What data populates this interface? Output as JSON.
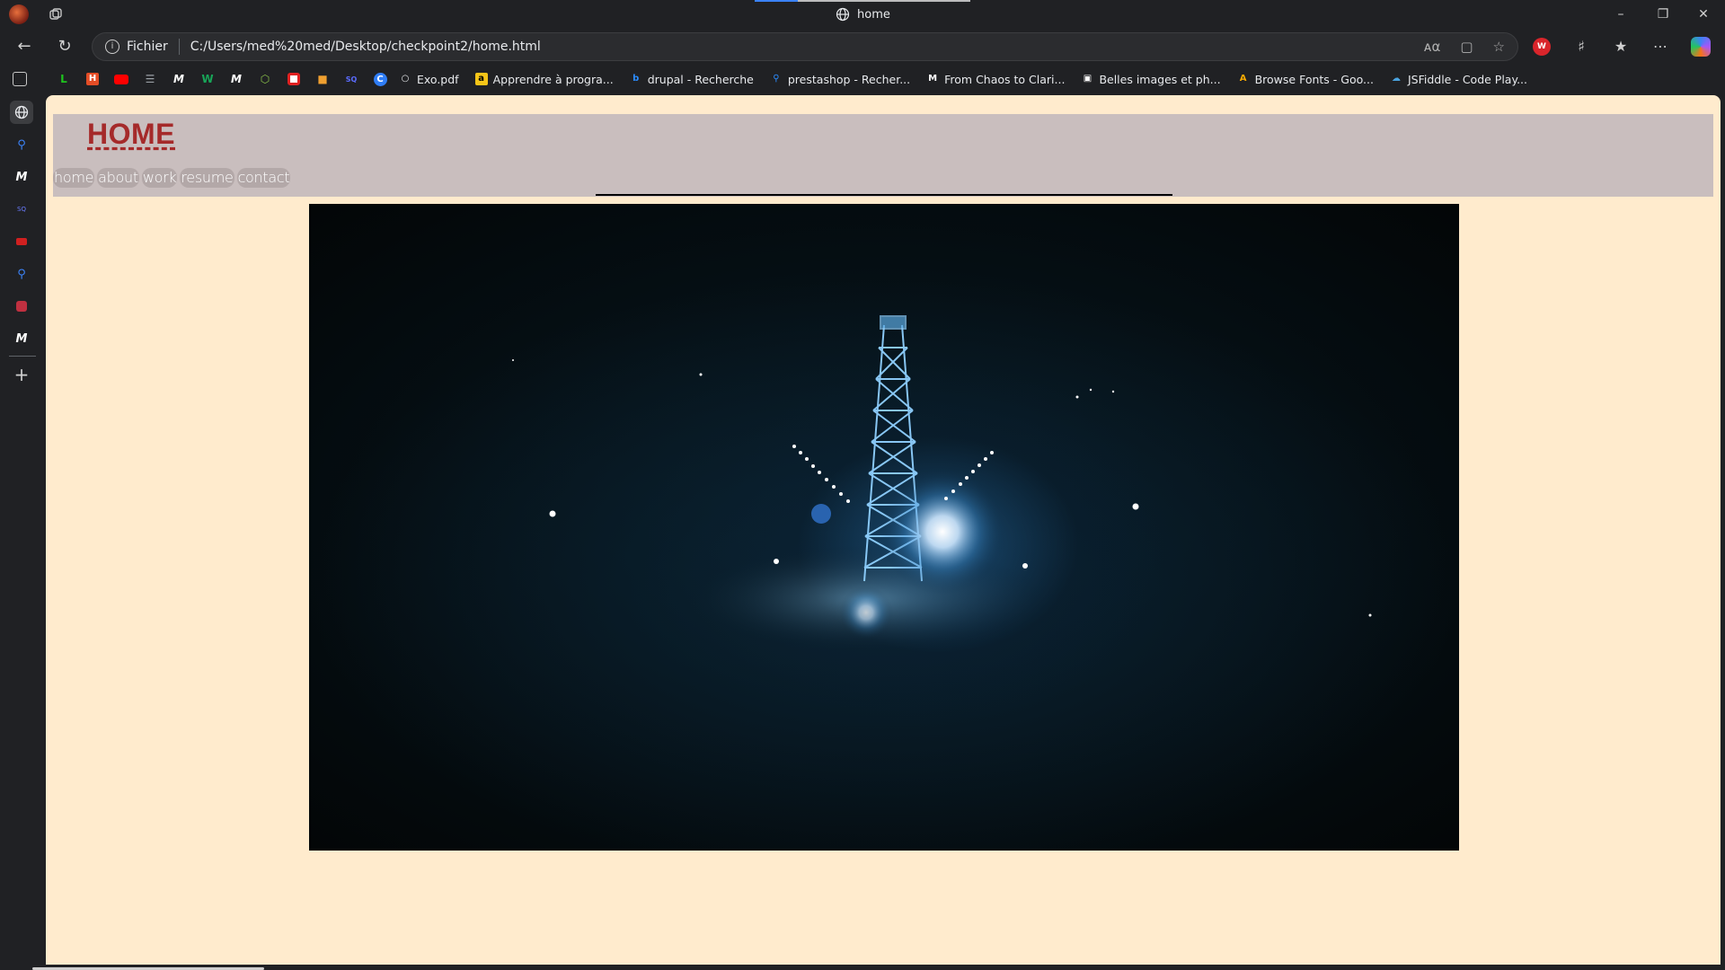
{
  "browser": {
    "tab_title": "home",
    "address": {
      "scheme_label": "Fichier",
      "url": "C:/Users/med%20med/Desktop/checkpoint2/home.html"
    },
    "extension_badge": "W",
    "bookmarks": [
      {
        "label": "Exo.pdf",
        "icon": "globe-icon",
        "color": "#e8eaed"
      },
      {
        "label": "Apprendre à progra...",
        "icon": "a-icon",
        "color": "#f5c518"
      },
      {
        "label": "drupal - Recherche",
        "icon": "bing-icon",
        "color": "#2b8cff"
      },
      {
        "label": "prestashop - Recher...",
        "icon": "search-icon",
        "color": "#2b8cff"
      },
      {
        "label": "From Chaos to Clari...",
        "icon": "medium-icon",
        "color": "#ffffff"
      },
      {
        "label": "Belles images et ph...",
        "icon": "unsplash-icon",
        "color": "#ffffff"
      },
      {
        "label": "Browse Fonts - Goo...",
        "icon": "google-fonts-icon",
        "color": "#f9ab00"
      },
      {
        "label": "JSFiddle - Code Play...",
        "icon": "cloud-icon",
        "color": "#4aa3df"
      }
    ],
    "sidebar_badge_text": "SQ"
  },
  "page": {
    "title": "HOME",
    "nav": {
      "home": "home",
      "about": "about",
      "work": "work",
      "resume": "resume",
      "contact": "contact"
    },
    "colors": {
      "background": "#ffebcd",
      "header": "#c9bebe",
      "title": "#a52a2a"
    }
  }
}
